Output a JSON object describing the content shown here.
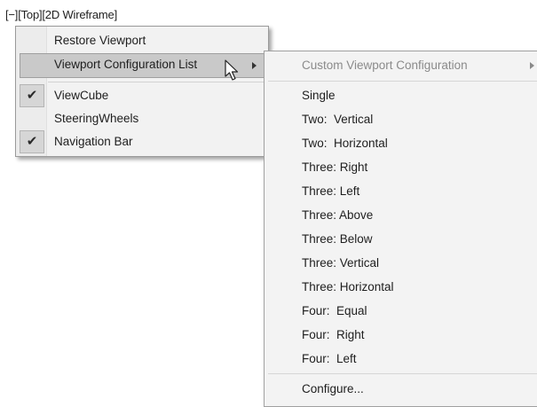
{
  "viewport_label": "[−][Top][2D Wireframe]",
  "context_menu": {
    "items": [
      {
        "label": "Restore Viewport",
        "checked": false
      },
      {
        "label": "Viewport Configuration List",
        "checked": false,
        "has_submenu": true,
        "hovered": true
      },
      {
        "label": "ViewCube",
        "checked": true
      },
      {
        "label": "SteeringWheels",
        "checked": false
      },
      {
        "label": "Navigation Bar",
        "checked": true
      }
    ],
    "check_glyph": "✔"
  },
  "submenu": {
    "items": [
      {
        "label": "Custom Viewport Configuration",
        "disabled": true,
        "has_submenu": true
      },
      {
        "label": "Single"
      },
      {
        "label": "Two:  Vertical"
      },
      {
        "label": "Two:  Horizontal"
      },
      {
        "label": "Three: Right"
      },
      {
        "label": "Three: Left"
      },
      {
        "label": "Three: Above"
      },
      {
        "label": "Three: Below"
      },
      {
        "label": "Three: Vertical"
      },
      {
        "label": "Three: Horizontal"
      },
      {
        "label": "Four:  Equal"
      },
      {
        "label": "Four:  Right"
      },
      {
        "label": "Four:  Left"
      },
      {
        "label": "Configure..."
      }
    ]
  },
  "colors": {
    "menu_bg": "#f2f2f2",
    "hover_bg": "#c9c9c9",
    "disabled_text": "#8a8a8a"
  },
  "icons": {
    "check": "check-icon",
    "submenu_arrow": "chevron-right-icon",
    "cursor": "mouse-pointer-icon"
  }
}
